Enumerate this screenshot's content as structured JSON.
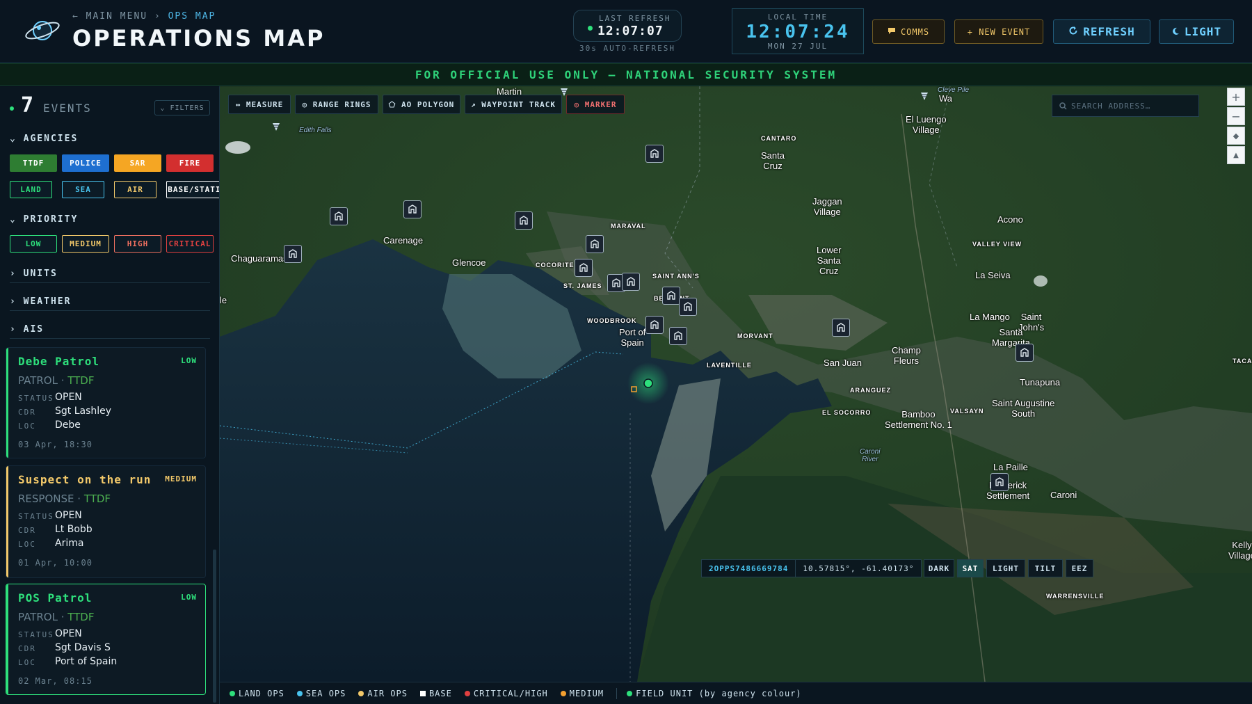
{
  "header": {
    "breadcrumb": {
      "back": "← MAIN MENU",
      "sep": "›",
      "current": "OPS MAP"
    },
    "title": "OPERATIONS MAP",
    "last_refresh": {
      "label": "LAST REFRESH",
      "time": "12:07:07",
      "sub": "30s AUTO-REFRESH"
    },
    "local_time": {
      "label": "LOCAL TIME",
      "time": "12:07:24",
      "date": "MON 27 JUL"
    },
    "buttons": {
      "comms": "COMMS",
      "new_event": "+ NEW EVENT",
      "refresh": "REFRESH",
      "light": "LIGHT"
    }
  },
  "banner": "FOR OFFICIAL USE ONLY — NATIONAL SECURITY SYSTEM",
  "sidebar": {
    "events_count": "7",
    "events_label": "EVENTS",
    "filters_label": "⌄ FILTERS",
    "sections": {
      "agencies": "⌄ AGENCIES",
      "priority": "⌄ PRIORITY",
      "units": "› UNITS",
      "weather": "› WEATHER",
      "ais": "› AIS"
    },
    "agencies": [
      {
        "label": "TTDF",
        "bg": "#2e7d32",
        "fg": "#ffffff"
      },
      {
        "label": "POLICE",
        "bg": "#1e6fd0",
        "fg": "#ffffff"
      },
      {
        "label": "SAR",
        "bg": "#f5a623",
        "fg": "#ffffff"
      },
      {
        "label": "FIRE",
        "bg": "#d32f2f",
        "fg": "#ffffff"
      }
    ],
    "domains": [
      {
        "label": "LAND",
        "color": "#2ee07c"
      },
      {
        "label": "SEA",
        "color": "#49c3ee"
      },
      {
        "label": "AIR",
        "color": "#f3c96a"
      },
      {
        "label": "BASE/STATION",
        "color": "#ffffff"
      }
    ],
    "priorities": [
      {
        "label": "LOW",
        "color": "#2ee07c"
      },
      {
        "label": "MEDIUM",
        "color": "#f3c96a"
      },
      {
        "label": "HIGH",
        "color": "#f07060"
      },
      {
        "label": "CRITICAL",
        "color": "#e04040"
      }
    ],
    "events": [
      {
        "title": "Debe Patrol",
        "priority": "LOW",
        "type": "PATROL",
        "agency": "TTDF",
        "status": "OPEN",
        "cdr": "Sgt Lashley",
        "loc": "Debe",
        "date": "03 Apr, 18:30",
        "color": "#2ee07c"
      },
      {
        "title": "Suspect on the run",
        "priority": "MEDIUM",
        "type": "RESPONSE",
        "agency": "TTDF",
        "status": "OPEN",
        "cdr": "Lt Bobb",
        "loc": "Arima",
        "date": "01 Apr, 10:00",
        "color": "#f3c96a"
      },
      {
        "title": "POS Patrol",
        "priority": "LOW",
        "type": "PATROL",
        "agency": "TTDF",
        "status": "OPEN",
        "cdr": "Sgt Davis S",
        "loc": "Port of Spain",
        "date": "02 Mar, 08:15",
        "color": "#2ee07c"
      }
    ],
    "row_labels": {
      "status": "STATUS",
      "cdr": "CDR",
      "loc": "LOC"
    }
  },
  "map": {
    "tools": [
      "↔ MEASURE",
      "◎ RANGE RINGS",
      "⬠ AO POLYGON",
      "↗ WAYPOINT TRACK",
      "◎ MARKER"
    ],
    "search_placeholder": "SEARCH ADDRESS…",
    "zoom": [
      "+",
      "−",
      "◆",
      "▲"
    ],
    "labels": [
      "Chaguaramas",
      "Carenage",
      "Glencoe",
      "COCORITE",
      "ST. JAMES",
      "MARAVAL",
      "SAINT ANN'S",
      "BELMONT",
      "WOODBROOK",
      "Port of Spain",
      "MORVANT",
      "LAVENTILLE",
      "CANTARO",
      "Santa Cruz",
      "Jaggan Village",
      "Lower Santa Cruz",
      "San Juan",
      "ARANGUEZ",
      "EL SOCORRO",
      "Champ Fleurs",
      "El Luengo Village",
      "Acono",
      "VALLEY VIEW",
      "La Seiva",
      "La Mango",
      "Saint John's",
      "Santa Margarita",
      "Tunapuna",
      "VALSAYN",
      "Saint Augustine South",
      "Bamboo Settlement No. 1",
      "Caroni River",
      "La Paille",
      "Frederick Settlement",
      "Caroni",
      "Edith Falls",
      "Cleve Pile",
      "WARRENSVILLE",
      "Martin",
      "Kelly Village",
      "Wa",
      "TACA",
      "le"
    ],
    "coord_id": "2OPPS7486669784",
    "coord_value": "10.57815°, -61.40173°",
    "basemaps": [
      "DARK",
      "SAT",
      "LIGHT",
      "TILT",
      "EEZ"
    ],
    "basemap_active": "SAT"
  },
  "legend": [
    {
      "label": "LAND OPS",
      "color": "#2ee07c",
      "shape": "dot"
    },
    {
      "label": "SEA OPS",
      "color": "#49c3ee",
      "shape": "dot"
    },
    {
      "label": "AIR OPS",
      "color": "#f3c96a",
      "shape": "dot"
    },
    {
      "label": "BASE",
      "color": "#ffffff",
      "shape": "square"
    },
    {
      "label": "CRITICAL/HIGH",
      "color": "#e04040",
      "shape": "dot"
    },
    {
      "label": "MEDIUM",
      "color": "#f3a030",
      "shape": "dot"
    },
    {
      "label": "FIELD UNIT (by agency colour)",
      "color": "#2ee07c",
      "shape": "dot"
    }
  ]
}
